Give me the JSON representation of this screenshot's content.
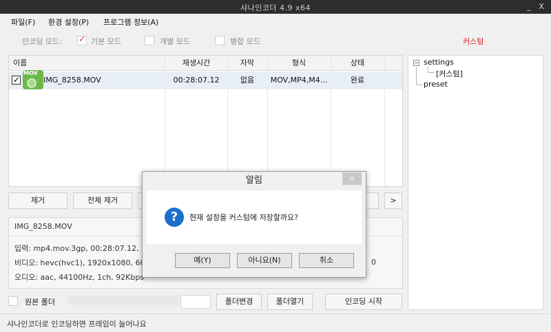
{
  "window": {
    "title": "샤나인코더 4.9 x64",
    "minimize_label": "_",
    "close_label": "X"
  },
  "menu": {
    "file": "파일(F)",
    "settings": "환경 설정(P)",
    "program_info": "프로그램 정보(A)"
  },
  "modes": {
    "label": "인코딩 모드:",
    "basic": "기본 모드",
    "individual": "개별 모드",
    "merge": "병합 모드",
    "basic_checked": true,
    "custom_link": "커스텀"
  },
  "file_list": {
    "columns": [
      "이름",
      "재생시간",
      "자막",
      "형식",
      "상태"
    ],
    "rows": [
      {
        "checked": true,
        "thumb_badge": "MOV",
        "name": "IMG_8258.MOV",
        "duration": "00:28:07.12",
        "subtitle": "없음",
        "format": "MOV,MP4,M4...",
        "status": "완료"
      }
    ]
  },
  "buttons": {
    "remove": "제거",
    "remove_all": "전체 제거",
    "next": ">"
  },
  "info": {
    "filename": "IMG_8258.MOV",
    "input": "입력: mp4.mov.3gp, 00:28:07.12, 2.",
    "video": "비디오: hevc(hvc1), 1920x1080, 60f",
    "audio": "오디오: aac, 44100Hz, 1ch, 92Kbps",
    "video_tail": "0"
  },
  "bottom": {
    "source_folder_label": "원본 폴더",
    "change_folder": "폴더변경",
    "open_folder": "폴더열기",
    "start_encoding": "인코딩 시작"
  },
  "status_bar": {
    "text": "샤나인코더로 인코딩하면 프레임이 늘어나요"
  },
  "tree": {
    "root_label": "settings",
    "expander": "−",
    "child_label": "[커스텀]",
    "preset_label": "preset"
  },
  "dialog": {
    "title": "알림",
    "close_label": "×",
    "icon_glyph": "?",
    "message": "현재 설정을 커스텀에 저장할까요?",
    "yes": "예(Y)",
    "no": "아니요(N)",
    "cancel": "취소"
  },
  "colors": {
    "titlebar_bg": "#2d2d2d",
    "accent_red": "#e02020",
    "check_pink": "#e0427a",
    "question_blue": "#1c6fc9",
    "thumb_green": "#6cb84a"
  }
}
